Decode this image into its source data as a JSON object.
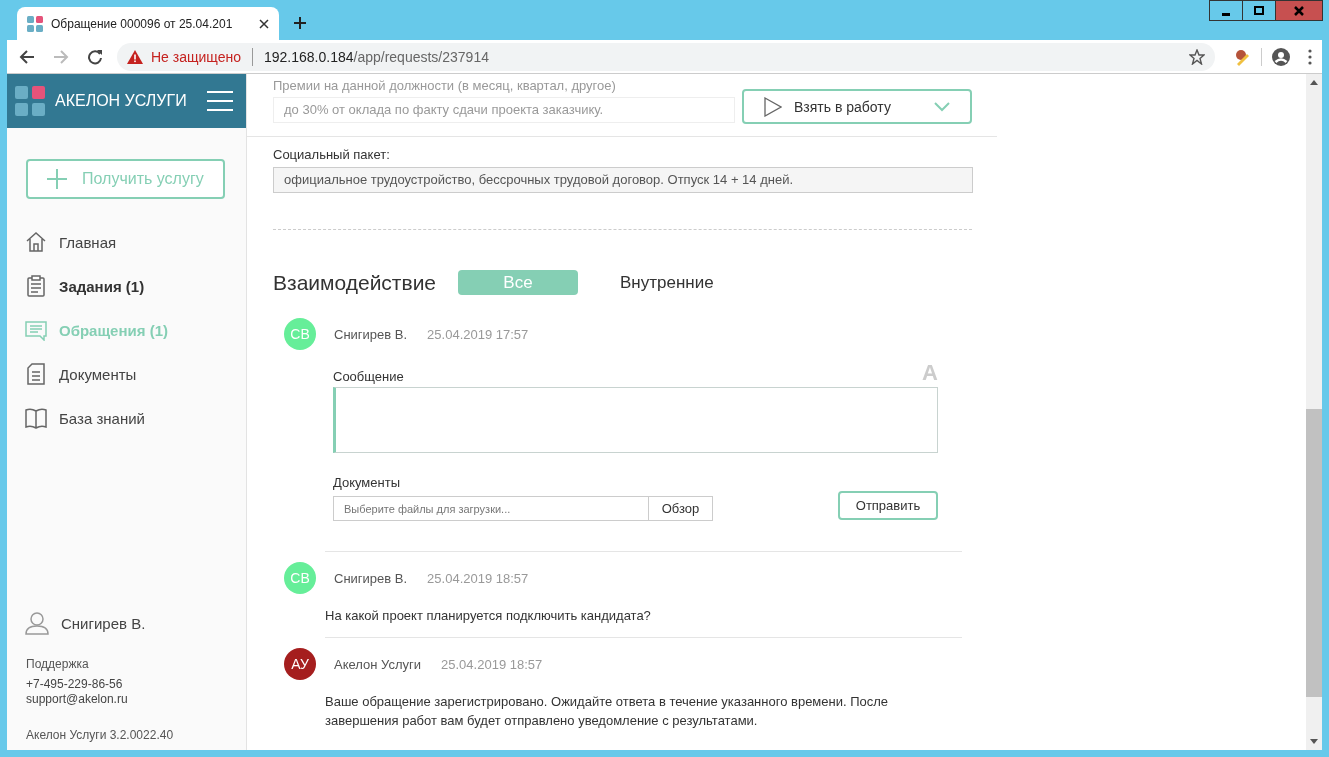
{
  "browser": {
    "tab_title": "Обращение 000096 от 25.04.201",
    "security": "Не защищено",
    "url_host": "192.168.0.184",
    "url_path": "/app/requests/237914"
  },
  "sidebar": {
    "brand": "АКЕЛОН УСЛУГИ",
    "action": "Получить услугу",
    "items": [
      {
        "kind": "home",
        "label": "Главная",
        "selected": false,
        "unread": false
      },
      {
        "kind": "clipboard",
        "label": "Задания (1)",
        "selected": false,
        "unread": true
      },
      {
        "kind": "chat",
        "label": "Обращения (1)",
        "selected": true,
        "unread": false
      },
      {
        "kind": "document",
        "label": "Документы",
        "selected": false,
        "unread": false
      },
      {
        "kind": "book",
        "label": "База знаний",
        "selected": false,
        "unread": false
      }
    ],
    "user": "Снигирев В.",
    "support_label": "Поддержка",
    "phone": "+7-495-229-86-56",
    "email": "support@akelon.ru",
    "version": "Акелон Услуги 3.2.0022.40"
  },
  "main": {
    "faded_field": {
      "label": "Премии на данной должности (в месяц, квартал, другое)",
      "value": "до 30% от оклада по факту сдачи проекта заказчику."
    },
    "action_button": "Взять в работу",
    "field": {
      "label": "Социальный пакет:",
      "value": "официальное трудоустройство, бессрочных трудовой договор. Отпуск 14 + 14 дней."
    },
    "interaction_title": "Взаимодействие",
    "tabs": [
      {
        "label": "Все",
        "selected": true
      },
      {
        "label": "Внутренние",
        "selected": false
      }
    ],
    "composer": {
      "initials": "СВ",
      "color": "#66ee99",
      "author": "Снигирев В.",
      "time": "25.04.2019 17:57",
      "message_label": "Сообщение",
      "format_glyph": "A",
      "docs_label": "Документы",
      "file_placeholder": "Выберите файлы для загрузки...",
      "browse": "Обзор",
      "send": "Отправить"
    },
    "messages": [
      {
        "initials": "СВ",
        "color": "#66ee99",
        "author": "Снигирев В.",
        "time": "25.04.2019 18:57",
        "text": "На какой проект планируется подключить кандидата?"
      },
      {
        "initials": "АУ",
        "color": "#a51e1e",
        "author": "Акелон Услуги",
        "time": "25.04.2019 18:57",
        "text": "Ваше обращение зарегистрировано. Ожидайте ответа в течение указанного времени. После завершения работ вам будет отправлено уведомление с результатами."
      }
    ]
  }
}
